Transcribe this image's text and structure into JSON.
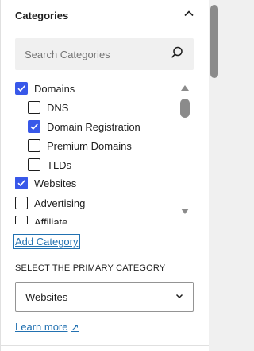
{
  "panel": {
    "title": "Categories"
  },
  "search": {
    "placeholder": "Search Categories"
  },
  "categories": [
    {
      "label": "Domains",
      "checked": true,
      "level": 0
    },
    {
      "label": "DNS",
      "checked": false,
      "level": 1
    },
    {
      "label": "Domain Registration",
      "checked": true,
      "level": 1
    },
    {
      "label": "Premium Domains",
      "checked": false,
      "level": 1
    },
    {
      "label": "TLDs",
      "checked": false,
      "level": 1
    },
    {
      "label": "Websites",
      "checked": true,
      "level": 0
    },
    {
      "label": "Advertising",
      "checked": false,
      "level": 0
    },
    {
      "label": "Affiliate",
      "checked": false,
      "level": 0
    }
  ],
  "add_category": {
    "label": "Add Category"
  },
  "primary": {
    "label": "SELECT THE PRIMARY CATEGORY",
    "selected": "Websites"
  },
  "learn_more": {
    "label": "Learn more",
    "icon": "external-link-icon"
  },
  "colors": {
    "accent": "#3858e9",
    "link": "#2271b1"
  }
}
